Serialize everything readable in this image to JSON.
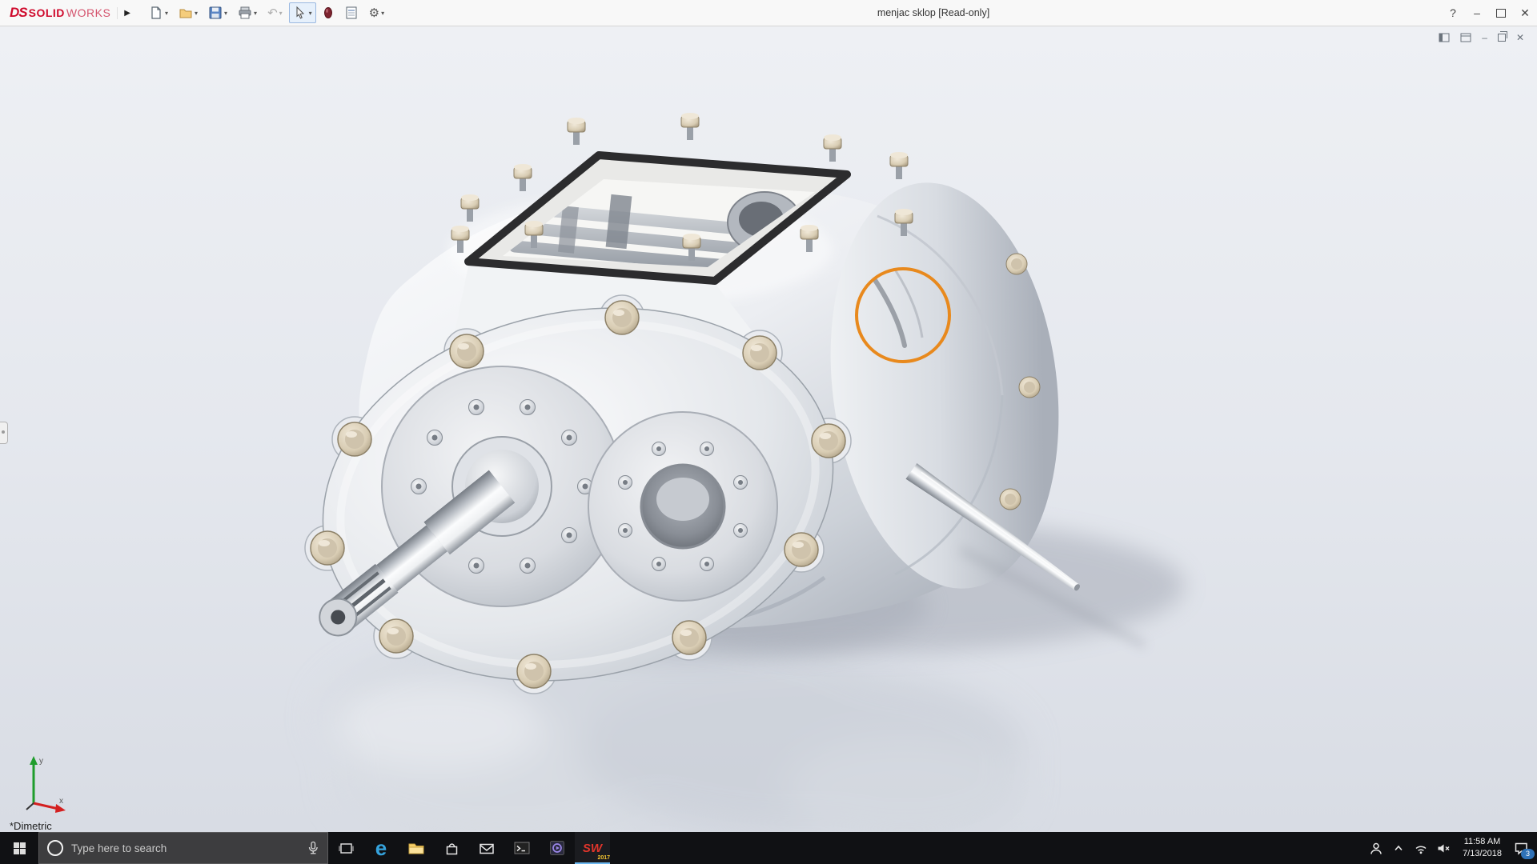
{
  "icons": {
    "caret": "▾",
    "flyout": "▶",
    "undo": "↶",
    "gear": "⚙",
    "edge_letter": "e"
  },
  "titlebar": {
    "logo": {
      "mark": "DS",
      "solid": "SOLID",
      "works": "WORKS"
    },
    "title": "menjac sklop [Read-only]",
    "controls": {
      "help": "?",
      "minimize": "–",
      "close": "✕"
    }
  },
  "doc_controls": {
    "minimize": "–",
    "close": "✕"
  },
  "viewport": {
    "view_label": "*Dimetric",
    "annotation_color": "#e8891d",
    "triad": {
      "x": "x",
      "y": "y"
    }
  },
  "taskbar": {
    "search_placeholder": "Type here to search",
    "solidworks": {
      "label": "SW",
      "year": "2017"
    },
    "clock": {
      "time": "11:58 AM",
      "date": "7/13/2018"
    },
    "notification_badge": "3"
  }
}
